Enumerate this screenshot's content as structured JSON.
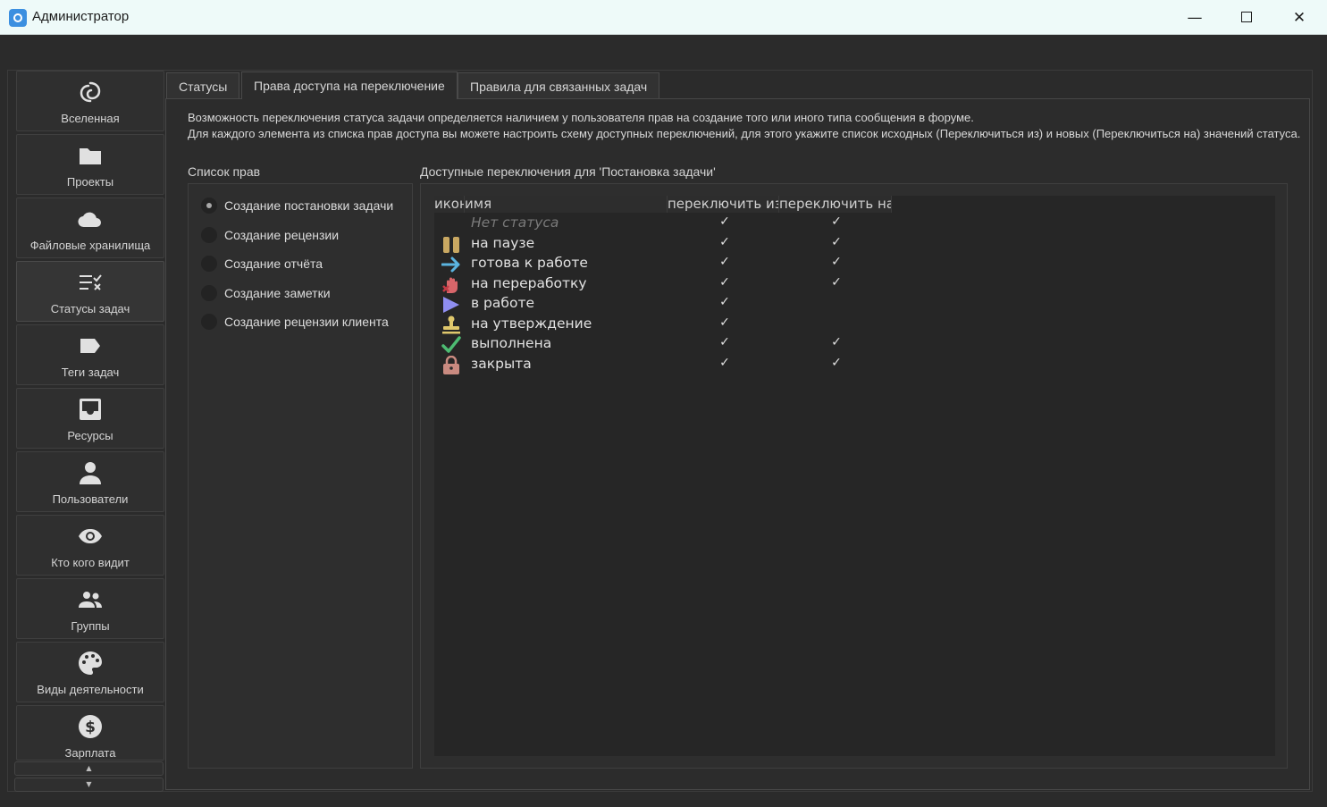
{
  "window": {
    "title": "Администратор",
    "minimize_glyph": "—",
    "close_glyph": "✕"
  },
  "sidebar": {
    "items": [
      {
        "label": "Вселенная",
        "icon": "universe-icon"
      },
      {
        "label": "Проекты",
        "icon": "folder-icon"
      },
      {
        "label": "Файловые хранилища",
        "icon": "cloud-icon"
      },
      {
        "label": "Статусы задач",
        "icon": "status-list-icon"
      },
      {
        "label": "Теги задач",
        "icon": "tag-icon"
      },
      {
        "label": "Ресурсы",
        "icon": "inbox-icon"
      },
      {
        "label": "Пользователи",
        "icon": "user-icon"
      },
      {
        "label": "Кто кого видит",
        "icon": "eye-icon"
      },
      {
        "label": "Группы",
        "icon": "group-icon"
      },
      {
        "label": "Виды деятельности",
        "icon": "palette-icon"
      },
      {
        "label": "Зарплата",
        "icon": "dollar-icon"
      }
    ],
    "active_index": 3,
    "scroll_up_glyph": "▲",
    "scroll_down_glyph": "▼"
  },
  "tabs": [
    {
      "label": "Статусы"
    },
    {
      "label": "Права доступа на переключение"
    },
    {
      "label": "Правила для связанных задач"
    }
  ],
  "active_tab": 1,
  "description": {
    "line1": "Возможность переключения статуса задачи определяется наличием у пользователя прав на создание того или иного типа сообщения в форуме.",
    "line2": "Для каждого элемента из списка прав доступа вы можете настроить схему доступных переключений, для этого укажите список исходных (Переключиться из) и новых (Переключиться на) значений статуса."
  },
  "rights": {
    "label": "Список прав",
    "items": [
      "Создание постановки задачи",
      "Создание рецензии",
      "Создание отчёта",
      "Создание заметки",
      "Создание рецензии клиента"
    ],
    "selected_index": 0
  },
  "switches": {
    "label": "Доступные переключения для 'Постановка задачи'",
    "columns": {
      "icon": "иконка",
      "name": "имя",
      "from": "переключить из",
      "to": "переключить на"
    },
    "check_glyph": "✓",
    "rows": [
      {
        "name": "Нет статуса",
        "icon": "none",
        "from": true,
        "to": true,
        "muted": true
      },
      {
        "name": "на паузе",
        "icon": "pause-icon",
        "from": true,
        "to": true
      },
      {
        "name": "готова к работе",
        "icon": "arrow-right-icon",
        "from": true,
        "to": true
      },
      {
        "name": "на переработку",
        "icon": "hand-stop-icon",
        "from": true,
        "to": true
      },
      {
        "name": "в работе",
        "icon": "play-icon",
        "from": true,
        "to": false
      },
      {
        "name": "на утверждение",
        "icon": "stamp-icon",
        "from": true,
        "to": false
      },
      {
        "name": "выполнена",
        "icon": "checkmark-icon",
        "from": true,
        "to": true
      },
      {
        "name": "закрыта",
        "icon": "lock-icon",
        "from": true,
        "to": true
      }
    ]
  },
  "colors": {
    "pause": "#c9a862",
    "arrow": "#5bb4e0",
    "hand": "#d8666a",
    "play": "#8f8ef0",
    "stamp": "#dfc76c",
    "check": "#4dbb72",
    "lock": "#c98a80"
  }
}
